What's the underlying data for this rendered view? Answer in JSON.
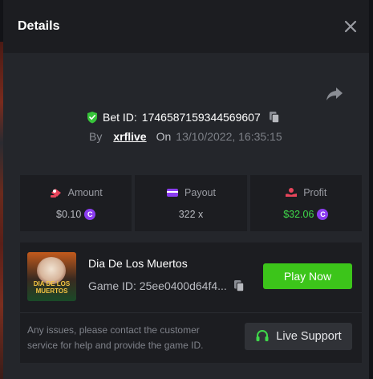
{
  "header": {
    "title": "Details"
  },
  "bet": {
    "id_label": "Bet ID:",
    "id_value": "1746587159344569607",
    "by_label": "By",
    "username": "xrflive",
    "on_label": "On",
    "date": "13/10/2022, 16:35:15"
  },
  "stats": {
    "amount": {
      "label": "Amount",
      "value": "$0.10"
    },
    "payout": {
      "label": "Payout",
      "value": "322 x"
    },
    "profit": {
      "label": "Profit",
      "value": "$32.06"
    }
  },
  "game": {
    "thumbnail_text": "DIA DE LOS MUERTOS",
    "name": "Dia De Los Muertos",
    "id_text": "Game ID: 25ee0400d64f4...",
    "play_label": "Play Now"
  },
  "support": {
    "help_text": "Any issues, please contact the customer service for help and provide the game ID.",
    "button_label": "Live Support"
  },
  "colors": {
    "accent_green": "#3cc51a",
    "profit_green": "#3fd94a",
    "coin_purple": "#8b3df0"
  },
  "icons": [
    "close-icon",
    "share-icon",
    "verified-shield-icon",
    "copy-icon",
    "amount-icon",
    "payout-icon",
    "profit-icon",
    "coin-icon",
    "headset-icon"
  ]
}
